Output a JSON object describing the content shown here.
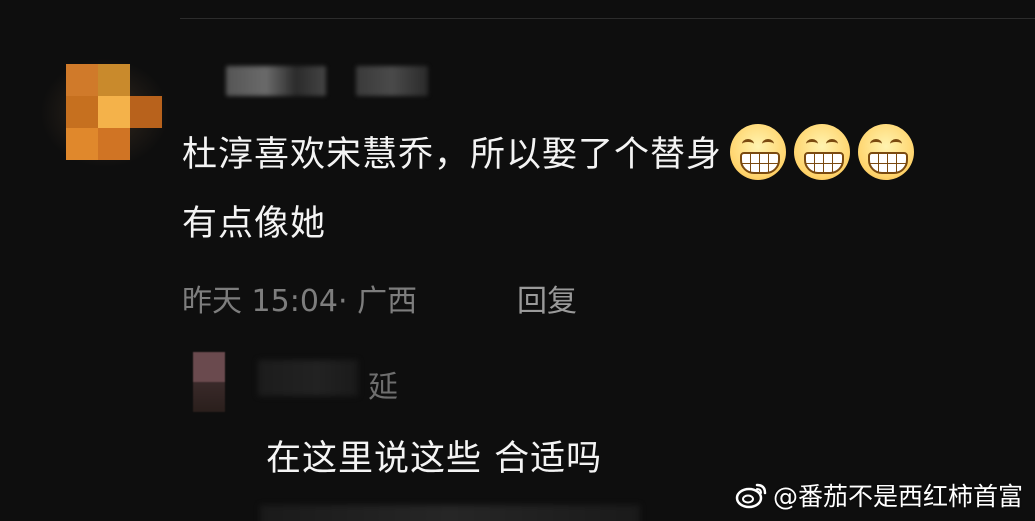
{
  "comment": {
    "text_line1": "杜淳喜欢宋慧乔，所以娶了个替身",
    "emojis": [
      "grinning-face-icon",
      "grinning-face-icon",
      "grinning-face-icon"
    ],
    "text_line2": "有点像她",
    "meta": "昨天 15:04· 广西",
    "reply_label": "回复"
  },
  "sub_reply": {
    "username_visible_char": "延",
    "text": "在这里说这些 合适吗"
  },
  "watermark": {
    "icon": "weibo-icon",
    "text": "@番茄不是西红柿首富"
  },
  "colors": {
    "background": "#0e0e0e",
    "primary_text": "#f4f4f4",
    "meta_text": "#7d7d7d"
  }
}
